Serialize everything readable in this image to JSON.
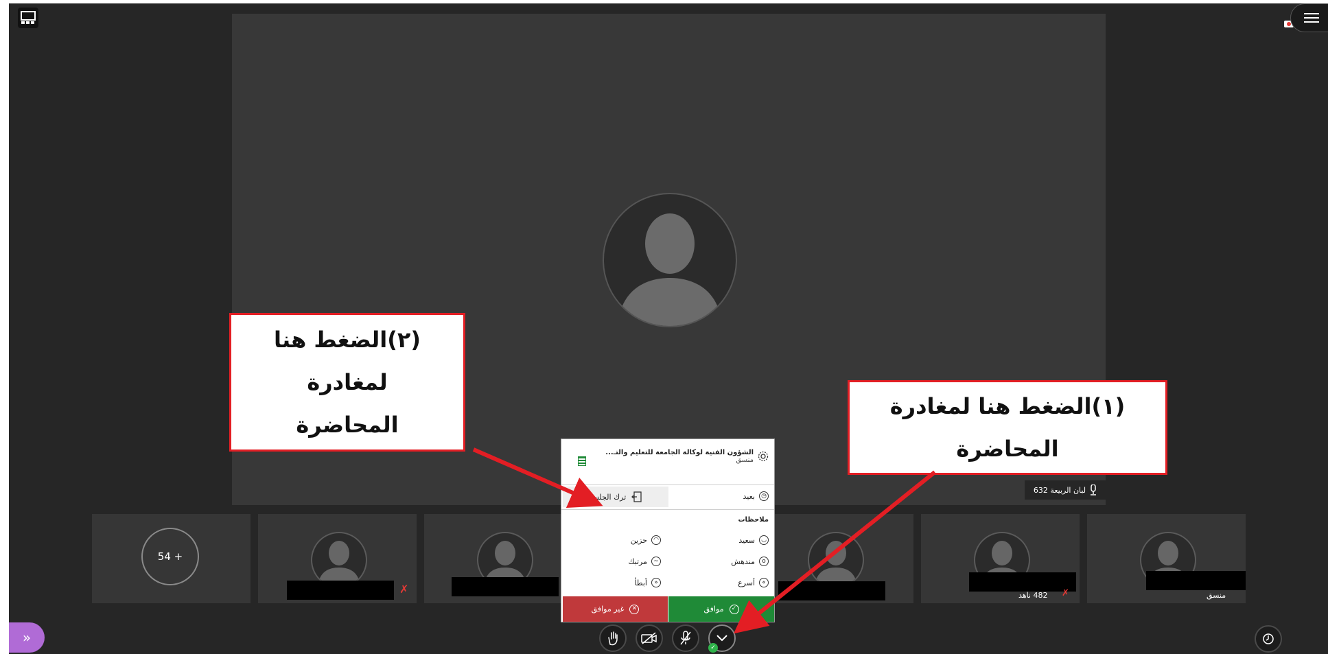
{
  "stage": {
    "speaker_label": "لبان الربيعة 632"
  },
  "tiles": {
    "more_count": "54 +",
    "labels": [
      "482 ناهد",
      "منسق"
    ]
  },
  "menu": {
    "title": "الشؤون الفنية لوكالة الجامعة للتعليم والتـ...",
    "role": "منسق",
    "away": "بعيد",
    "leave": "ترك الجلسة",
    "feedback_heading": "ملاحظات",
    "happy": "سعيد",
    "sad": "حزين",
    "surprised": "مندهش",
    "confused": "مرتبك",
    "faster": "أسرع",
    "slower": "أبطأ",
    "agree": "موافق",
    "disagree": "غير موافق"
  },
  "callouts": {
    "one": [
      "(١)الضغط هنا لمغادرة",
      "المحاضرة"
    ],
    "two": [
      "(٢)الضغط هنا",
      "لمغادرة",
      "المحاضرة"
    ]
  },
  "colors": {
    "accent_purple": "#b06bd6",
    "agree_green": "#1f8a37",
    "disagree_red": "#c0393b",
    "annotation_red": "#e31e24",
    "status_green": "#2fb34a"
  }
}
